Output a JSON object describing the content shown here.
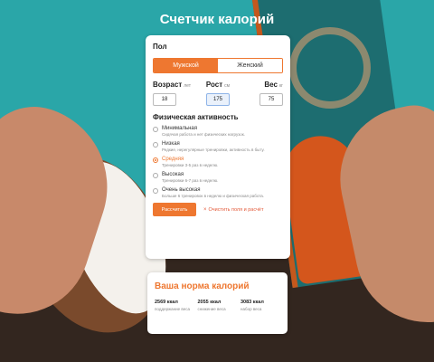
{
  "app": {
    "title": "Счетчик калорий"
  },
  "gender": {
    "label": "Пол",
    "options": [
      "Мужской",
      "Женский"
    ],
    "selected": "Мужской"
  },
  "metrics": [
    {
      "label": "Возраст",
      "unit": "лет",
      "value": "18"
    },
    {
      "label": "Рост",
      "unit": "см",
      "value": "175"
    },
    {
      "label": "Вес",
      "unit": "кг",
      "value": "75"
    }
  ],
  "activity": {
    "label": "Физическая активность",
    "selected": "Средняя",
    "options": [
      {
        "name": "Минимальная",
        "desc": "Сидячая работа и нет физических нагрузок."
      },
      {
        "name": "Низкая",
        "desc": "Редкие, нерегулярные тренировки, активность в быту."
      },
      {
        "name": "Средняя",
        "desc": "Тренировки 3-5 раз в неделю."
      },
      {
        "name": "Высокая",
        "desc": "Тренировки 6-7 раз в неделю."
      },
      {
        "name": "Очень высокая",
        "desc": "Больше 6 тренировок в неделю и физическая работа."
      }
    ]
  },
  "actions": {
    "calculate": "Рассчитать",
    "clear": "Очистить поля и расчёт",
    "clear_icon": "×"
  },
  "result": {
    "title": "Ваша норма калорий",
    "items": [
      {
        "value": "2569 ккал",
        "label": "поддержание веса"
      },
      {
        "value": "2055 ккал",
        "label": "снижение веса"
      },
      {
        "value": "3083 ккал",
        "label": "набор веса"
      }
    ]
  },
  "colors": {
    "accent": "#ee7730",
    "clear_link": "#e35a3a",
    "background_teal": "#2aa6a8"
  },
  "icons": {
    "clear": "close-icon"
  }
}
